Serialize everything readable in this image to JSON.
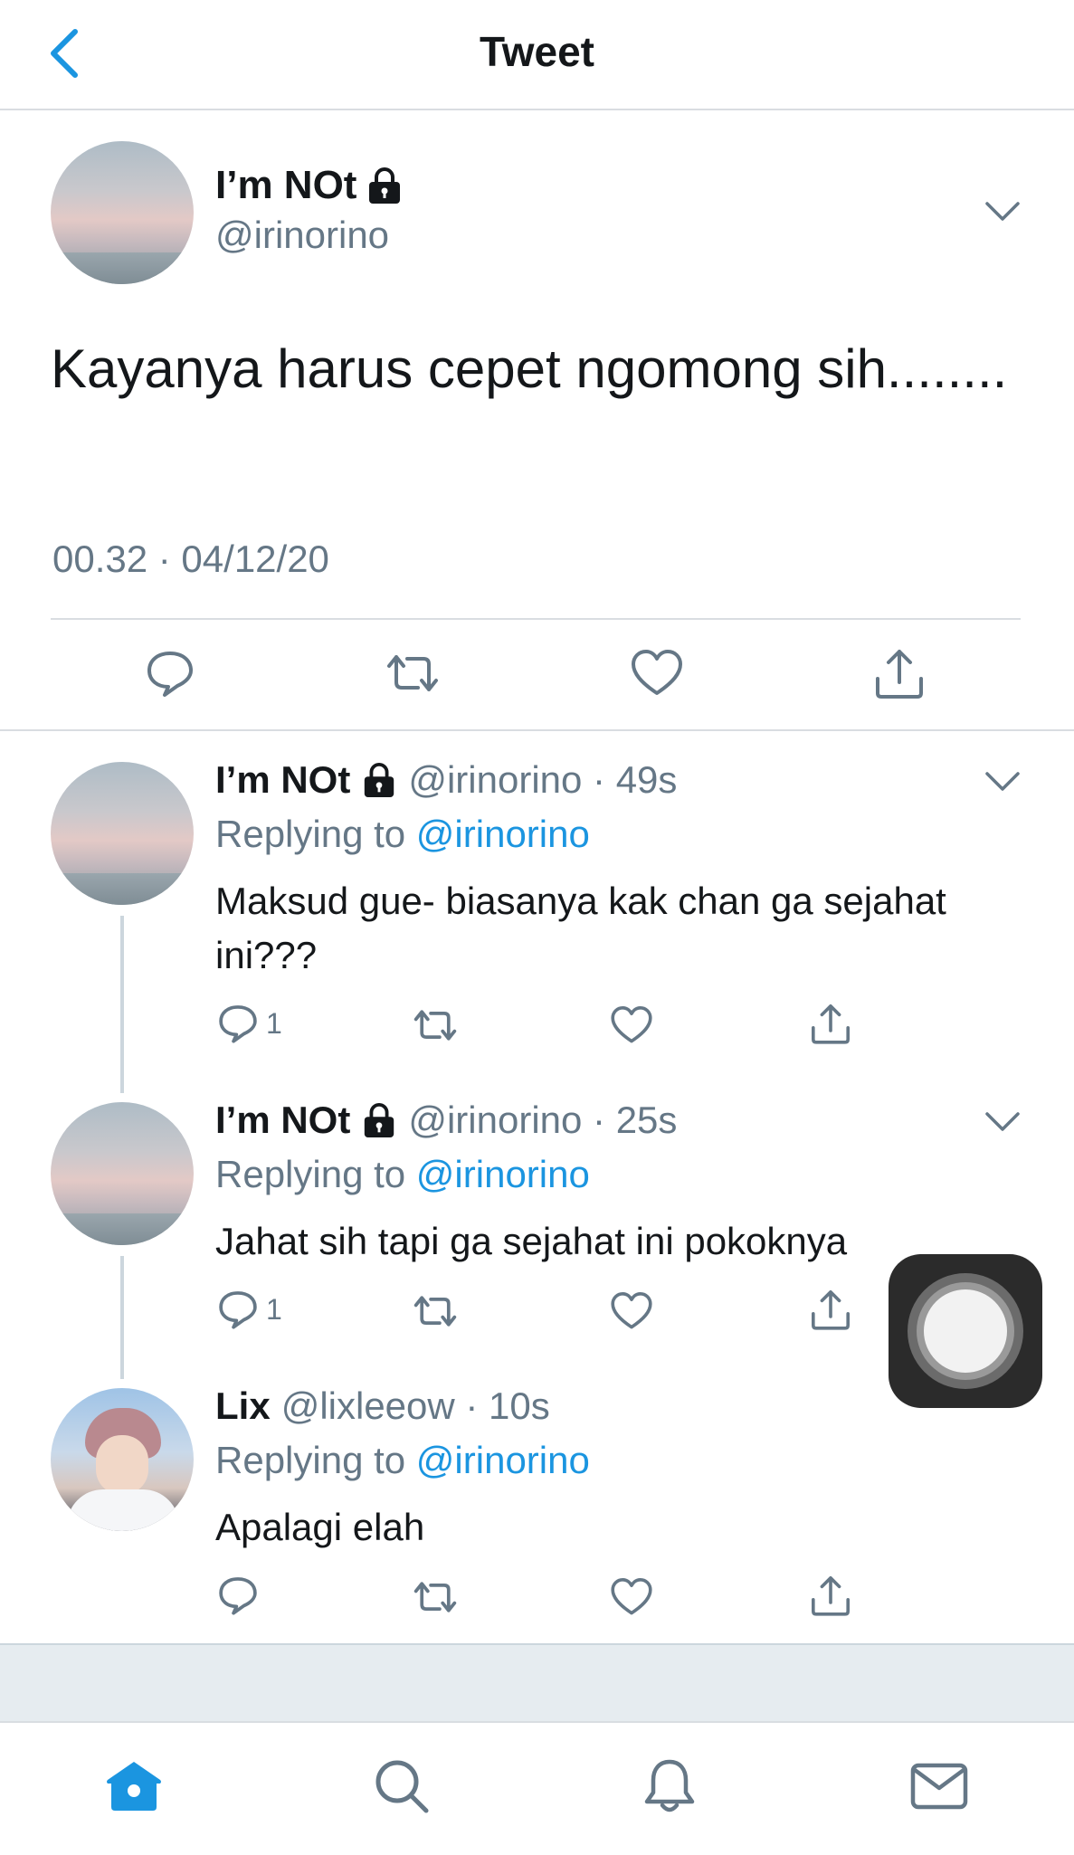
{
  "header": {
    "title": "Tweet",
    "back_icon": "back-chevron-icon"
  },
  "main_tweet": {
    "name": "I’m NOt",
    "handle": "@irinorino",
    "text": "Kayanya harus cepet ngomong sih........",
    "timestamp": "00.32 · 04/12/20"
  },
  "replies": [
    {
      "name": "I’m NOt",
      "handle_time": "@irinorino · 49s",
      "replying_prefix": "Replying to ",
      "replying_to": "@irinorino",
      "text": "Maksud gue- biasanya kak chan ga sejahat ini???",
      "reply_count": "1"
    },
    {
      "name": "I’m NOt",
      "handle_time": "@irinorino · 25s",
      "replying_prefix": "Replying to ",
      "replying_to": "@irinorino",
      "text": "Jahat sih tapi ga sejahat ini pokoknya",
      "reply_count": "1"
    },
    {
      "name": "Lix",
      "handle_time": "@lixleeow · 10s",
      "replying_prefix": "Replying to ",
      "replying_to": "@irinorino",
      "text": "Apalagi elah",
      "reply_count": ""
    }
  ],
  "colors": {
    "accent": "#1b95e0",
    "secondary_text": "#657786",
    "divider": "#d9dde1",
    "tab_active": "#1b95e0"
  },
  "tabs": [
    "home-icon",
    "search-icon",
    "notifications-icon",
    "messages-icon"
  ]
}
